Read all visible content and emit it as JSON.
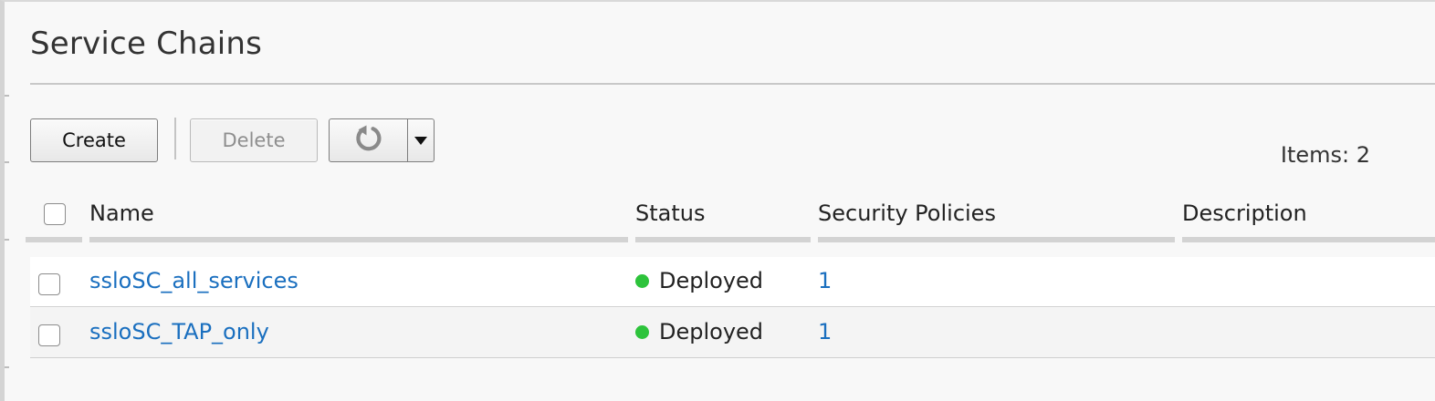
{
  "page": {
    "title": "Service Chains"
  },
  "toolbar": {
    "create_label": "Create",
    "delete_label": "Delete",
    "refresh_icon": "refresh-icon",
    "dropdown_icon": "caret-down-icon"
  },
  "items_count": "Items: 2",
  "table": {
    "columns": [
      "Name",
      "Status",
      "Security Policies",
      "Description"
    ],
    "rows": [
      {
        "name": "ssloSC_all_services",
        "status": "Deployed",
        "security_policies": "1",
        "description": ""
      },
      {
        "name": "ssloSC_TAP_only",
        "status": "Deployed",
        "security_policies": "1",
        "description": ""
      }
    ]
  },
  "colors": {
    "link": "#1a6fbf",
    "status_ok": "#2dc33b"
  }
}
